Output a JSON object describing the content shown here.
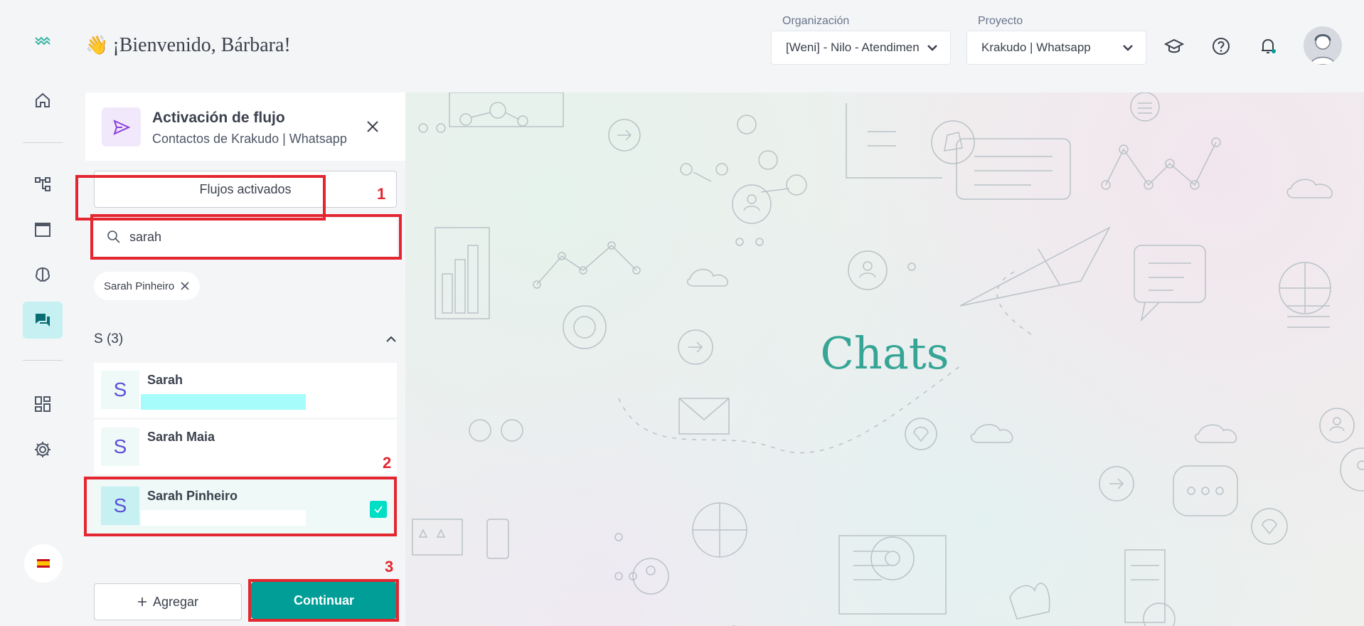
{
  "header": {
    "welcome_emoji": "👋",
    "welcome": "¡Bienvenido, Bárbara!",
    "org_label": "Organización",
    "org_value": "[Weni] - Nilo - Atendimento",
    "project_label": "Proyecto",
    "project_value": "Krakudo | Whatsapp"
  },
  "sidebar": {
    "items": [
      "home-icon",
      "flows-icon",
      "window-icon",
      "brain-icon",
      "chats-icon",
      "dashboard-icon",
      "settings-icon"
    ],
    "active": "chats-icon",
    "language_flag": "es"
  },
  "panel": {
    "title": "Activación de flujo",
    "subtitle": "Contactos de Krakudo | Whatsapp",
    "tab_label": "Flujos activados",
    "search_value": "sarah",
    "chip_label": "Sarah Pinheiro",
    "group_label": "S (3)",
    "contacts": [
      {
        "initial": "S",
        "name": "Sarah"
      },
      {
        "initial": "S",
        "name": "Sarah Maia"
      },
      {
        "initial": "S",
        "name": "Sarah Pinheiro",
        "checked": true
      }
    ],
    "add_label": "Agregar",
    "continue_label": "Continuar"
  },
  "annotations": [
    "1",
    "2",
    "3"
  ],
  "main": {
    "title": "Chats"
  },
  "colors": {
    "accent": "#009e96",
    "highlight": "#e3262f",
    "check": "#00dec6",
    "title": "#36a595"
  }
}
